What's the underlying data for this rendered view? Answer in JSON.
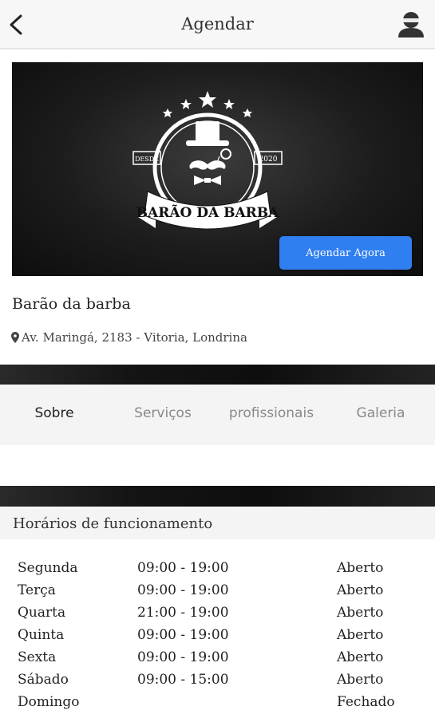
{
  "topbar": {
    "title": "Agendar",
    "back_icon": "chevron-left-icon",
    "profile_icon": "user-avatar-icon"
  },
  "hero": {
    "logo": {
      "since_label": "DESDE",
      "year": "2020",
      "banner_text": "BARÃO DA BARBA"
    },
    "book_button": "Agendar Agora"
  },
  "shop": {
    "name": "Barão da barba",
    "address": "Av. Maringá, 2183 - Vitoria, Londrina"
  },
  "tabs": [
    {
      "label": "Sobre",
      "active": true
    },
    {
      "label": "Serviços",
      "active": false
    },
    {
      "label": "profissionais",
      "active": false
    },
    {
      "label": "Galeria",
      "active": false
    }
  ],
  "hours_section": {
    "title": "Horários de funcionamento",
    "rows": [
      {
        "day": "Segunda",
        "time": "09:00 - 19:00",
        "status": "Aberto"
      },
      {
        "day": "Terça",
        "time": "09:00 - 19:00",
        "status": "Aberto"
      },
      {
        "day": "Quarta",
        "time": "21:00 - 19:00",
        "status": "Aberto"
      },
      {
        "day": "Quinta",
        "time": "09:00 - 19:00",
        "status": "Aberto"
      },
      {
        "day": "Sexta",
        "time": "09:00 - 19:00",
        "status": "Aberto"
      },
      {
        "day": "Sábado",
        "time": "09:00 - 15:00",
        "status": "Aberto"
      },
      {
        "day": "Domingo",
        "time": "",
        "status": "Fechado"
      }
    ]
  },
  "colors": {
    "accent": "#2f7ff0",
    "band": "#141414",
    "tab_active": "#222222",
    "tab_inactive": "#888888"
  }
}
